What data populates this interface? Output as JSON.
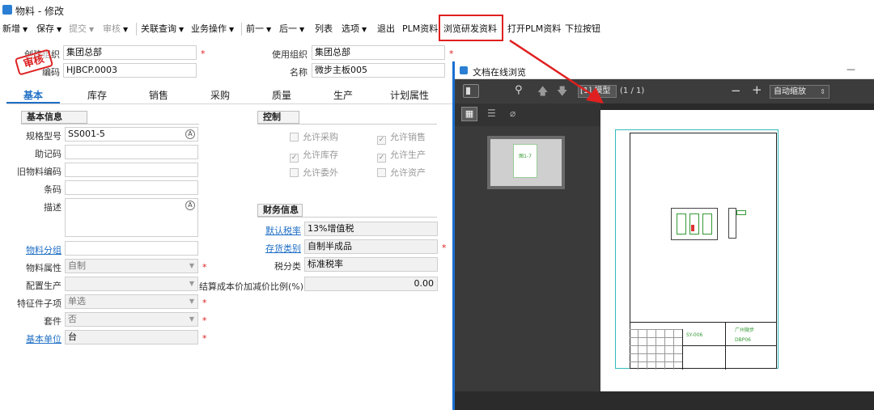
{
  "window": {
    "title": "物料 - 修改"
  },
  "toolbar": {
    "new": "新增",
    "save": "保存",
    "submit": "提交",
    "audit": "审核",
    "related_query": "关联查询",
    "business_ops": "业务操作",
    "prev": "前一",
    "next": "后一",
    "list": "列表",
    "options": "选项",
    "exit": "退出",
    "plm_data": "PLM资料",
    "browse_rd": "浏览研发资料",
    "open_plm": "打开PLM资料",
    "dropdown_btn": "下拉按钮"
  },
  "header": {
    "create_org_label": "创建组织",
    "create_org_value": "集团总部",
    "code_label": "编码",
    "code_value": "HJBCP.0003",
    "use_org_label": "使用组织",
    "use_org_value": "集团总部",
    "name_label": "名称",
    "name_value": "微步主板005",
    "stamp": "审核"
  },
  "tabs": [
    "基本",
    "库存",
    "销售",
    "采购",
    "质量",
    "生产",
    "计划属性"
  ],
  "basic": {
    "section": "基本信息",
    "spec_label": "规格型号",
    "spec_value": "SS001-5",
    "mnemonic_label": "助记码",
    "old_code_label": "旧物料编码",
    "barcode_label": "条码",
    "desc_label": "描述",
    "group_label": "物料分组",
    "attr_label": "物料属性",
    "attr_value": "自制",
    "config_label": "配置生产",
    "feature_label": "特征件子项",
    "feature_value": "单选",
    "kit_label": "套件",
    "kit_value": "否",
    "unit_label": "基本单位",
    "unit_value": "台"
  },
  "control": {
    "section": "控制",
    "allow_purchase": "允许采购",
    "allow_sale": "允许销售",
    "allow_stock": "允许库存",
    "allow_produce": "允许生产",
    "allow_outsource": "允许委外",
    "allow_asset": "允许资产"
  },
  "finance": {
    "section": "财务信息",
    "tax_label": "默认税率",
    "tax_value": "13%增值税",
    "stock_cat_label": "存货类别",
    "stock_cat_value": "自制半成品",
    "tax_class_label": "税分类",
    "tax_class_value": "标准税率",
    "cost_label": "结算成本价加减价比例(%)",
    "cost_value": "0.00"
  },
  "viewer": {
    "title": "文档在线浏览",
    "close": "—",
    "page_label": "[1] 模型",
    "page_count": "(1 / 1)",
    "zoom": "自动缩放",
    "thumb_text": "图1-7",
    "drawing_title": "广州微步",
    "drawing_code": "SY-006",
    "drawing_sub": "DBP06"
  }
}
